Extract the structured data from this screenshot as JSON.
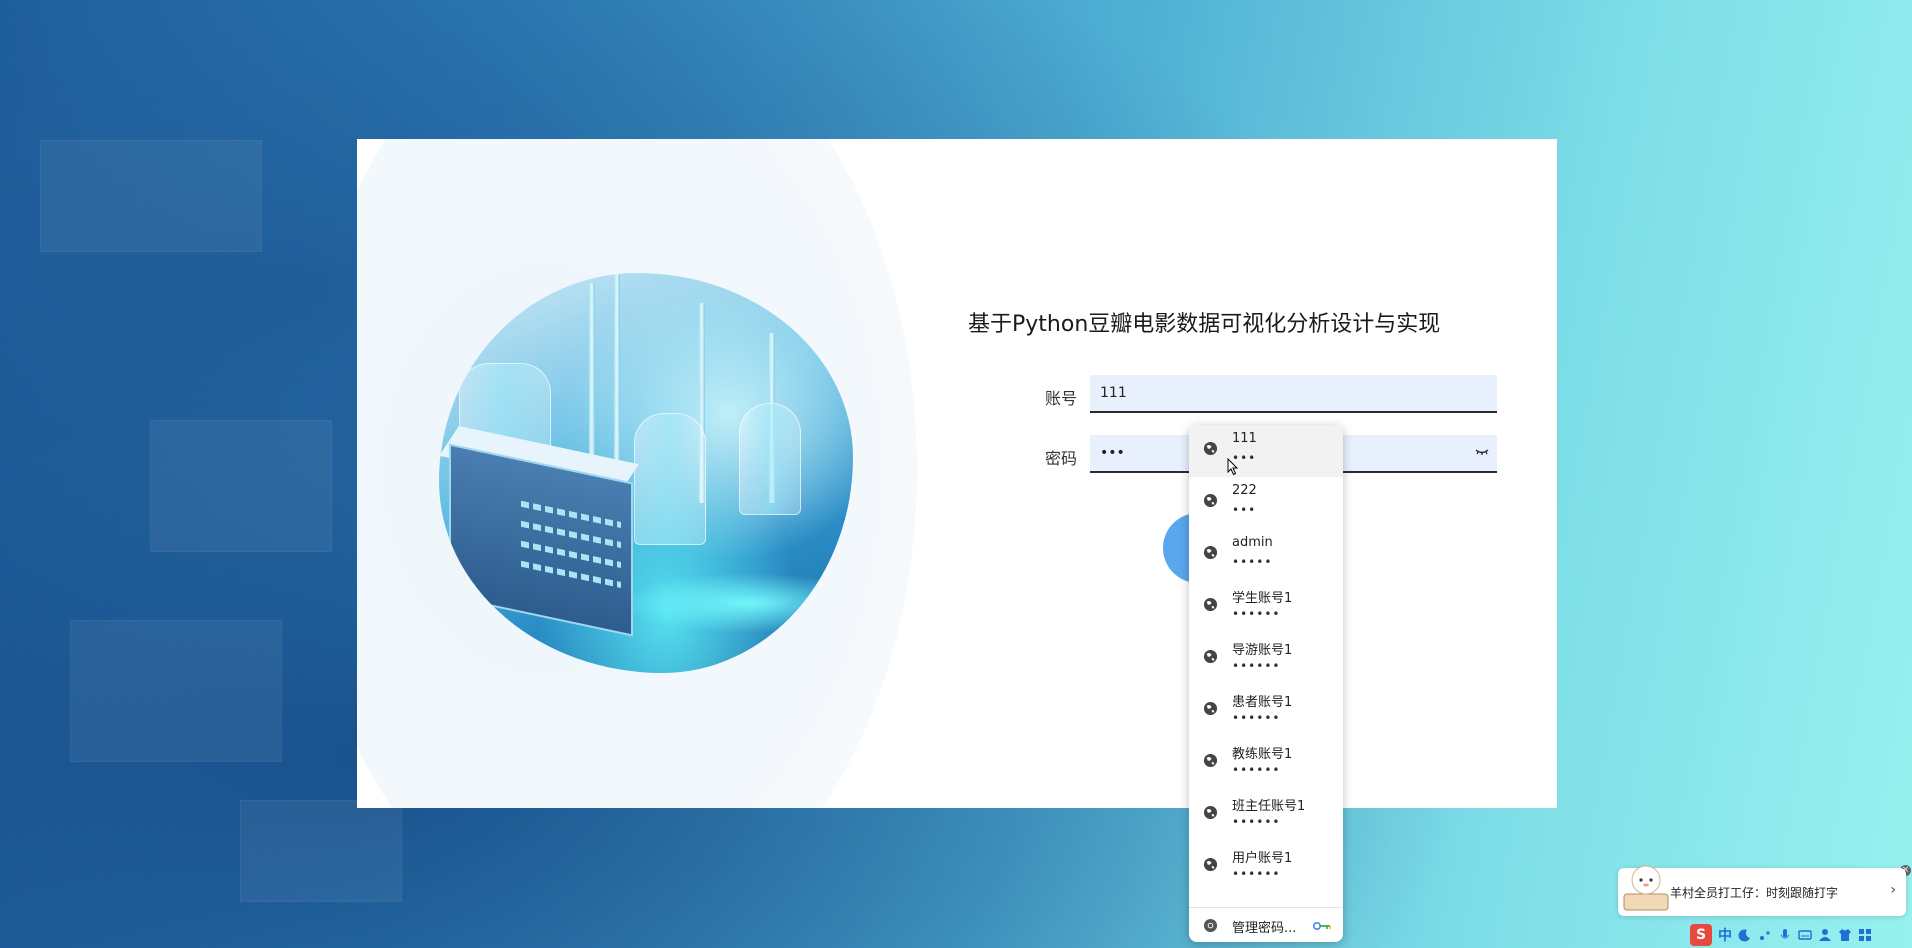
{
  "page": {
    "title": "基于Python豆瓣电影数据可视化分析设计与实现"
  },
  "form": {
    "account_label": "账号",
    "account_value": "111",
    "password_label": "密码",
    "password_value": "•••"
  },
  "autocomplete": {
    "items": [
      {
        "name": "111",
        "password": "•••"
      },
      {
        "name": "222",
        "password": "•••"
      },
      {
        "name": "admin",
        "password": "•••••"
      },
      {
        "name": "学生账号1",
        "password": "••••••"
      },
      {
        "name": "导游账号1",
        "password": "••••••"
      },
      {
        "name": "患者账号1",
        "password": "••••••"
      },
      {
        "name": "教练账号1",
        "password": "••••••"
      },
      {
        "name": "班主任账号1",
        "password": "••••••"
      },
      {
        "name": "用户账号1",
        "password": "••••••"
      }
    ],
    "manage_label": "管理密码..."
  },
  "ime": {
    "notice": "羊村全员打工仔：时刻跟随打字",
    "chevron": "›",
    "logo": "S",
    "mode": "中"
  },
  "colors": {
    "accent": "#5aa7ee",
    "field_bg": "#e8f0fe",
    "ime_logo": "#e8493e"
  }
}
